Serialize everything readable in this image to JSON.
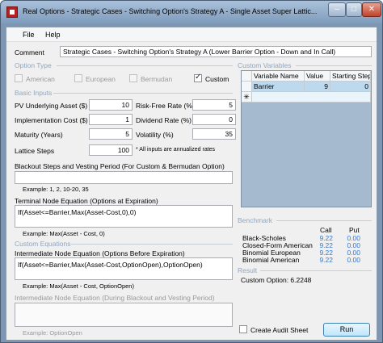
{
  "window": {
    "title": "Real Options - Strategic Cases - Switching Option's Strategy A - Single Asset Super Lattic...",
    "min_symbol": "–",
    "max_symbol": "□",
    "close_symbol": "✕"
  },
  "menu": {
    "file": "File",
    "help": "Help"
  },
  "comment": {
    "label": "Comment",
    "value": "Strategic Cases - Switching Option's Strategy A (Lower Barrier Option - Down and In Call)"
  },
  "option_type": {
    "group_label": "Option Type",
    "options": [
      {
        "label": "American",
        "checked": false,
        "enabled": false
      },
      {
        "label": "European",
        "checked": false,
        "enabled": false
      },
      {
        "label": "Bermudan",
        "checked": false,
        "enabled": false
      },
      {
        "label": "Custom",
        "checked": true,
        "enabled": true
      }
    ]
  },
  "basic_inputs": {
    "group_label": "Basic Inputs",
    "pv_label": "PV Underlying Asset ($)",
    "pv_value": "10",
    "impl_label": "Implementation Cost ($)",
    "impl_value": "1",
    "maturity_label": "Maturity (Years)",
    "maturity_value": "5",
    "lattice_label": "Lattice Steps",
    "lattice_value": "100",
    "rf_label": "Risk-Free Rate (%)",
    "rf_value": "5",
    "div_label": "Dividend Rate (%)",
    "div_value": "0",
    "vol_label": "Volatility (%)",
    "vol_value": "35",
    "note": "* All inputs are annualized rates"
  },
  "blackout": {
    "label": "Blackout Steps and Vesting Period (For Custom & Bermudan Option)",
    "value": "",
    "example": "Example: 1, 2, 10-20, 35"
  },
  "terminal": {
    "label": "Terminal Node Equation (Options at Expiration)",
    "value": "If(Asset<=Barrier,Max(Asset-Cost,0),0)",
    "example": "Example: Max(Asset - Cost, 0)"
  },
  "custom_equations": {
    "group_label": "Custom Equations",
    "intermediate_label": "Intermediate Node Equation (Options Before Expiration)",
    "intermediate_value": "If(Asset<=Barrier,Max(Asset-Cost,OptionOpen),OptionOpen)",
    "intermediate_example": "Example: Max(Asset - Cost, OptionOpen)",
    "blackout_label": "Intermediate Node Equation (During Blackout and Vesting Period)",
    "blackout_value": "",
    "blackout_example": "Example: OptionOpen"
  },
  "custom_variables": {
    "group_label": "Custom Variables",
    "columns": [
      "Variable Name",
      "Value",
      "Starting Step"
    ],
    "rows": [
      {
        "name": "Barrier",
        "value": "9",
        "step": "0"
      }
    ],
    "new_row_marker": "✳"
  },
  "benchmark": {
    "group_label": "Benchmark",
    "call_header": "Call",
    "put_header": "Put",
    "rows": [
      {
        "name": "Black-Scholes",
        "call": "9.22",
        "put": "0.00"
      },
      {
        "name": "Closed-Form American",
        "call": "9.22",
        "put": "0.00"
      },
      {
        "name": "Binomial European",
        "call": "9.22",
        "put": "0.00"
      },
      {
        "name": "Binomial American",
        "call": "9.22",
        "put": "0.00"
      }
    ]
  },
  "result": {
    "group_label": "Result",
    "text": "Custom Option: 6.2248"
  },
  "audit": {
    "label": "Create Audit Sheet",
    "checked": false
  },
  "run_button": "Run"
}
